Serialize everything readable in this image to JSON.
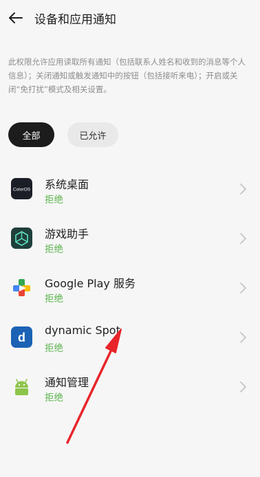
{
  "header": {
    "title": "设备和应用通知",
    "back_icon": "arrow-left-icon"
  },
  "description": "此权限允许应用读取所有通知（包括联系人姓名和收到的消息等个人信息）；关闭通知或触发通知中的按钮（包括接听来电）；开启或关闭“免打扰”模式及相关设置。",
  "filters": {
    "all_label": "全部",
    "allowed_label": "已允许",
    "selected": "全部"
  },
  "apps": [
    {
      "name": "系统桌面",
      "status": "拒绝",
      "icon": "coloros-icon",
      "icon_text": "ColorOS"
    },
    {
      "name": "游戏助手",
      "status": "拒绝",
      "icon": "game-assistant-icon"
    },
    {
      "name": "Google Play 服务",
      "status": "拒绝",
      "icon": "google-play-services-icon"
    },
    {
      "name": "dynamic Spot",
      "status": "拒绝",
      "icon": "dynamic-spot-icon",
      "icon_text": "d"
    },
    {
      "name": "通知管理",
      "status": "拒绝",
      "icon": "android-icon"
    }
  ],
  "colors": {
    "status_denied": "#5bb44d",
    "annotation_arrow": "#e8252b"
  }
}
